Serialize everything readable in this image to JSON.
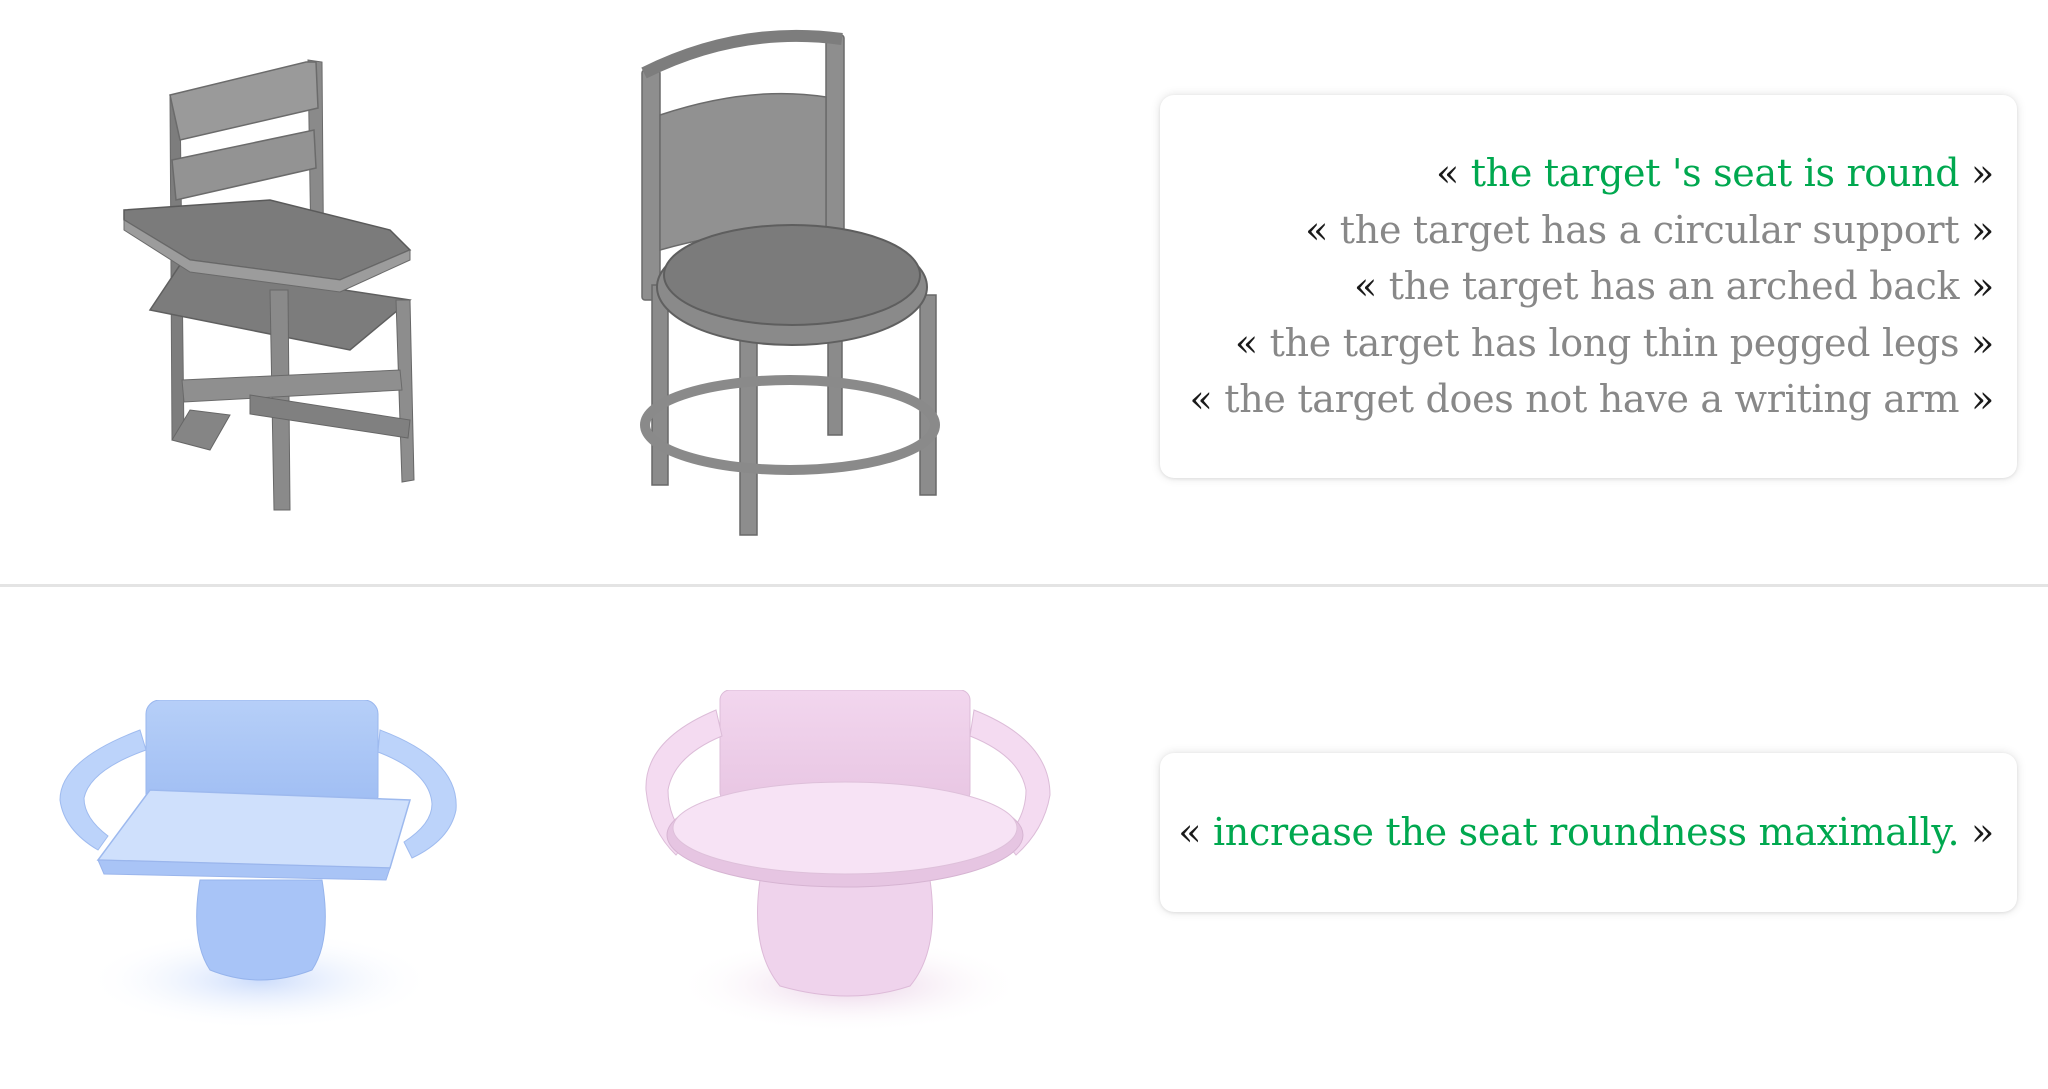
{
  "colors": {
    "target_text": "#00a84f",
    "distractor_text": "#888888",
    "guillemet": "#1a1a1a",
    "chair_gray": "#8c8c8c",
    "chair_blue": "#a9c6f6",
    "chair_pink": "#f0d2ec"
  },
  "icons": {
    "gray_chair_a": "school-desk-chair",
    "gray_chair_b": "round-seat-chair",
    "blue_chair": "armchair-square-seat",
    "pink_chair": "armchair-round-seat"
  },
  "top_panel": {
    "open_quote": "«",
    "close_quote": "»",
    "utterances": [
      {
        "text": "the target 's seat is round",
        "kind": "target"
      },
      {
        "text": "the target has a circular support",
        "kind": "distractor"
      },
      {
        "text": "the target has an arched back",
        "kind": "distractor"
      },
      {
        "text": "the target has long thin pegged legs",
        "kind": "distractor"
      },
      {
        "text": "the target does not have a writing arm",
        "kind": "distractor"
      }
    ]
  },
  "bottom_panel": {
    "open_quote": "«",
    "close_quote": "»",
    "instruction": "increase the seat roundness maximally.",
    "instruction_kind": "target"
  }
}
